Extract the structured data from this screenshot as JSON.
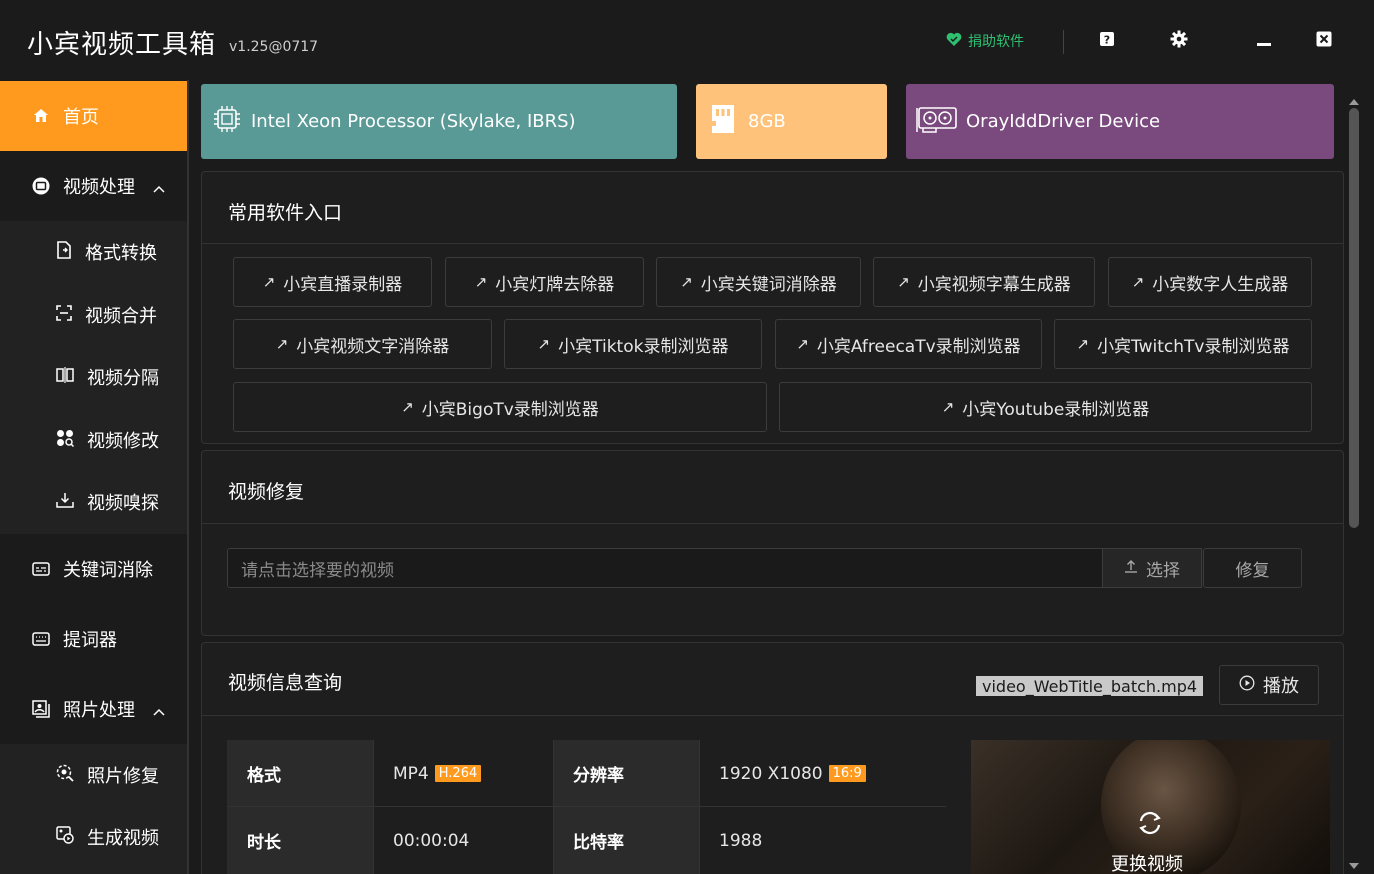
{
  "app": {
    "title": "小宾视频工具箱",
    "version": "v1.25@0717"
  },
  "titlebar": {
    "donate": "捐助软件",
    "help_icon": "question-icon",
    "settings_icon": "gear-icon",
    "minimize_icon": "minimize-icon",
    "close_icon": "close-icon"
  },
  "sidebar": {
    "home": "首页",
    "video_processing": "视频处理",
    "video_sub": [
      "格式转换",
      "视频合并",
      "视频分隔",
      "视频修改",
      "视频嗅探"
    ],
    "keyword_removal": "关键词消除",
    "prompter": "提词器",
    "photo_processing": "照片处理",
    "photo_sub": [
      "照片修复",
      "生成视频"
    ]
  },
  "hardware": {
    "cpu": "Intel Xeon Processor (Skylake, IBRS)",
    "ram": "8GB",
    "gpu": "OrayIddDriver Device",
    "colors": {
      "cpu": "#5a9a96",
      "ram": "#ffc27a",
      "gpu": "#7a4a7e"
    }
  },
  "software": {
    "title": "常用软件入口",
    "row1": [
      "小宾直播录制器",
      "小宾灯牌去除器",
      "小宾关键词消除器",
      "小宾视频字幕生成器",
      "小宾数字人生成器"
    ],
    "row2": [
      "小宾视频文字消除器",
      "小宾Tiktok录制浏览器",
      "小宾AfreecaTv录制浏览器",
      "小宾TwitchTv录制浏览器"
    ],
    "row3": [
      "小宾BigoTv录制浏览器",
      "小宾Youtube录制浏览器"
    ]
  },
  "repair": {
    "title": "视频修复",
    "placeholder": "请点击选择要的视频",
    "choose": "选择",
    "repair": "修复"
  },
  "info": {
    "title": "视频信息查询",
    "filename": "video_WebTitle_batch.mp4",
    "play": "播放",
    "format_label": "格式",
    "format_value": "MP4",
    "format_badge": "H.264",
    "resolution_label": "分辨率",
    "resolution_value": "1920 X1080",
    "resolution_badge": "16:9",
    "duration_label": "时长",
    "duration_value": "00:00:04",
    "bitrate_label": "比特率",
    "bitrate_value": "1988",
    "change_video": "更换视频"
  },
  "accent": "#ff9a1f"
}
